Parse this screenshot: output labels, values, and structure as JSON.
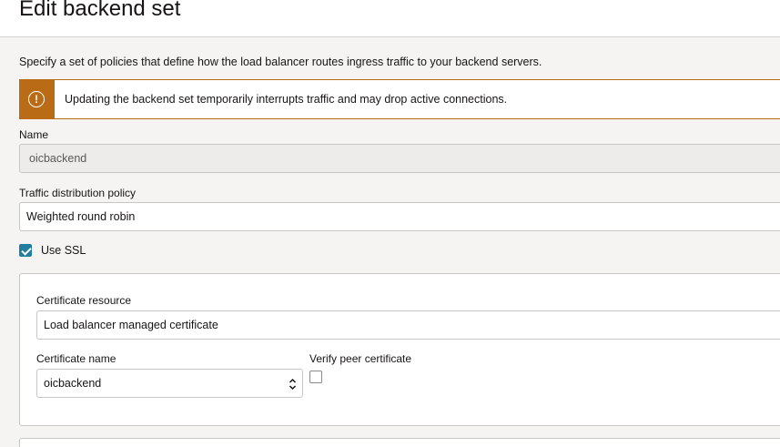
{
  "page": {
    "title": "Edit backend set",
    "description": "Specify a set of policies that define how the load balancer routes ingress traffic to your backend servers."
  },
  "warning": {
    "icon": "exclamation-circle-icon",
    "message": "Updating the backend set temporarily interrupts traffic and may drop active connections.",
    "color": "#b96b15"
  },
  "form": {
    "name": {
      "label": "Name",
      "value": "oicbackend",
      "disabled": true
    },
    "policy": {
      "label": "Traffic distribution policy",
      "value": "Weighted round robin"
    },
    "use_ssl": {
      "label": "Use SSL",
      "checked": true
    },
    "ssl": {
      "certificate_resource": {
        "label": "Certificate resource",
        "value": "Load balancer managed certificate"
      },
      "certificate_name": {
        "label": "Certificate name",
        "value": "oicbackend"
      },
      "verify_peer": {
        "label": "Verify peer certificate",
        "checked": false
      }
    }
  },
  "colors": {
    "accent": "#227e9e",
    "warning": "#b96b15",
    "background": "#f5f4f2"
  }
}
